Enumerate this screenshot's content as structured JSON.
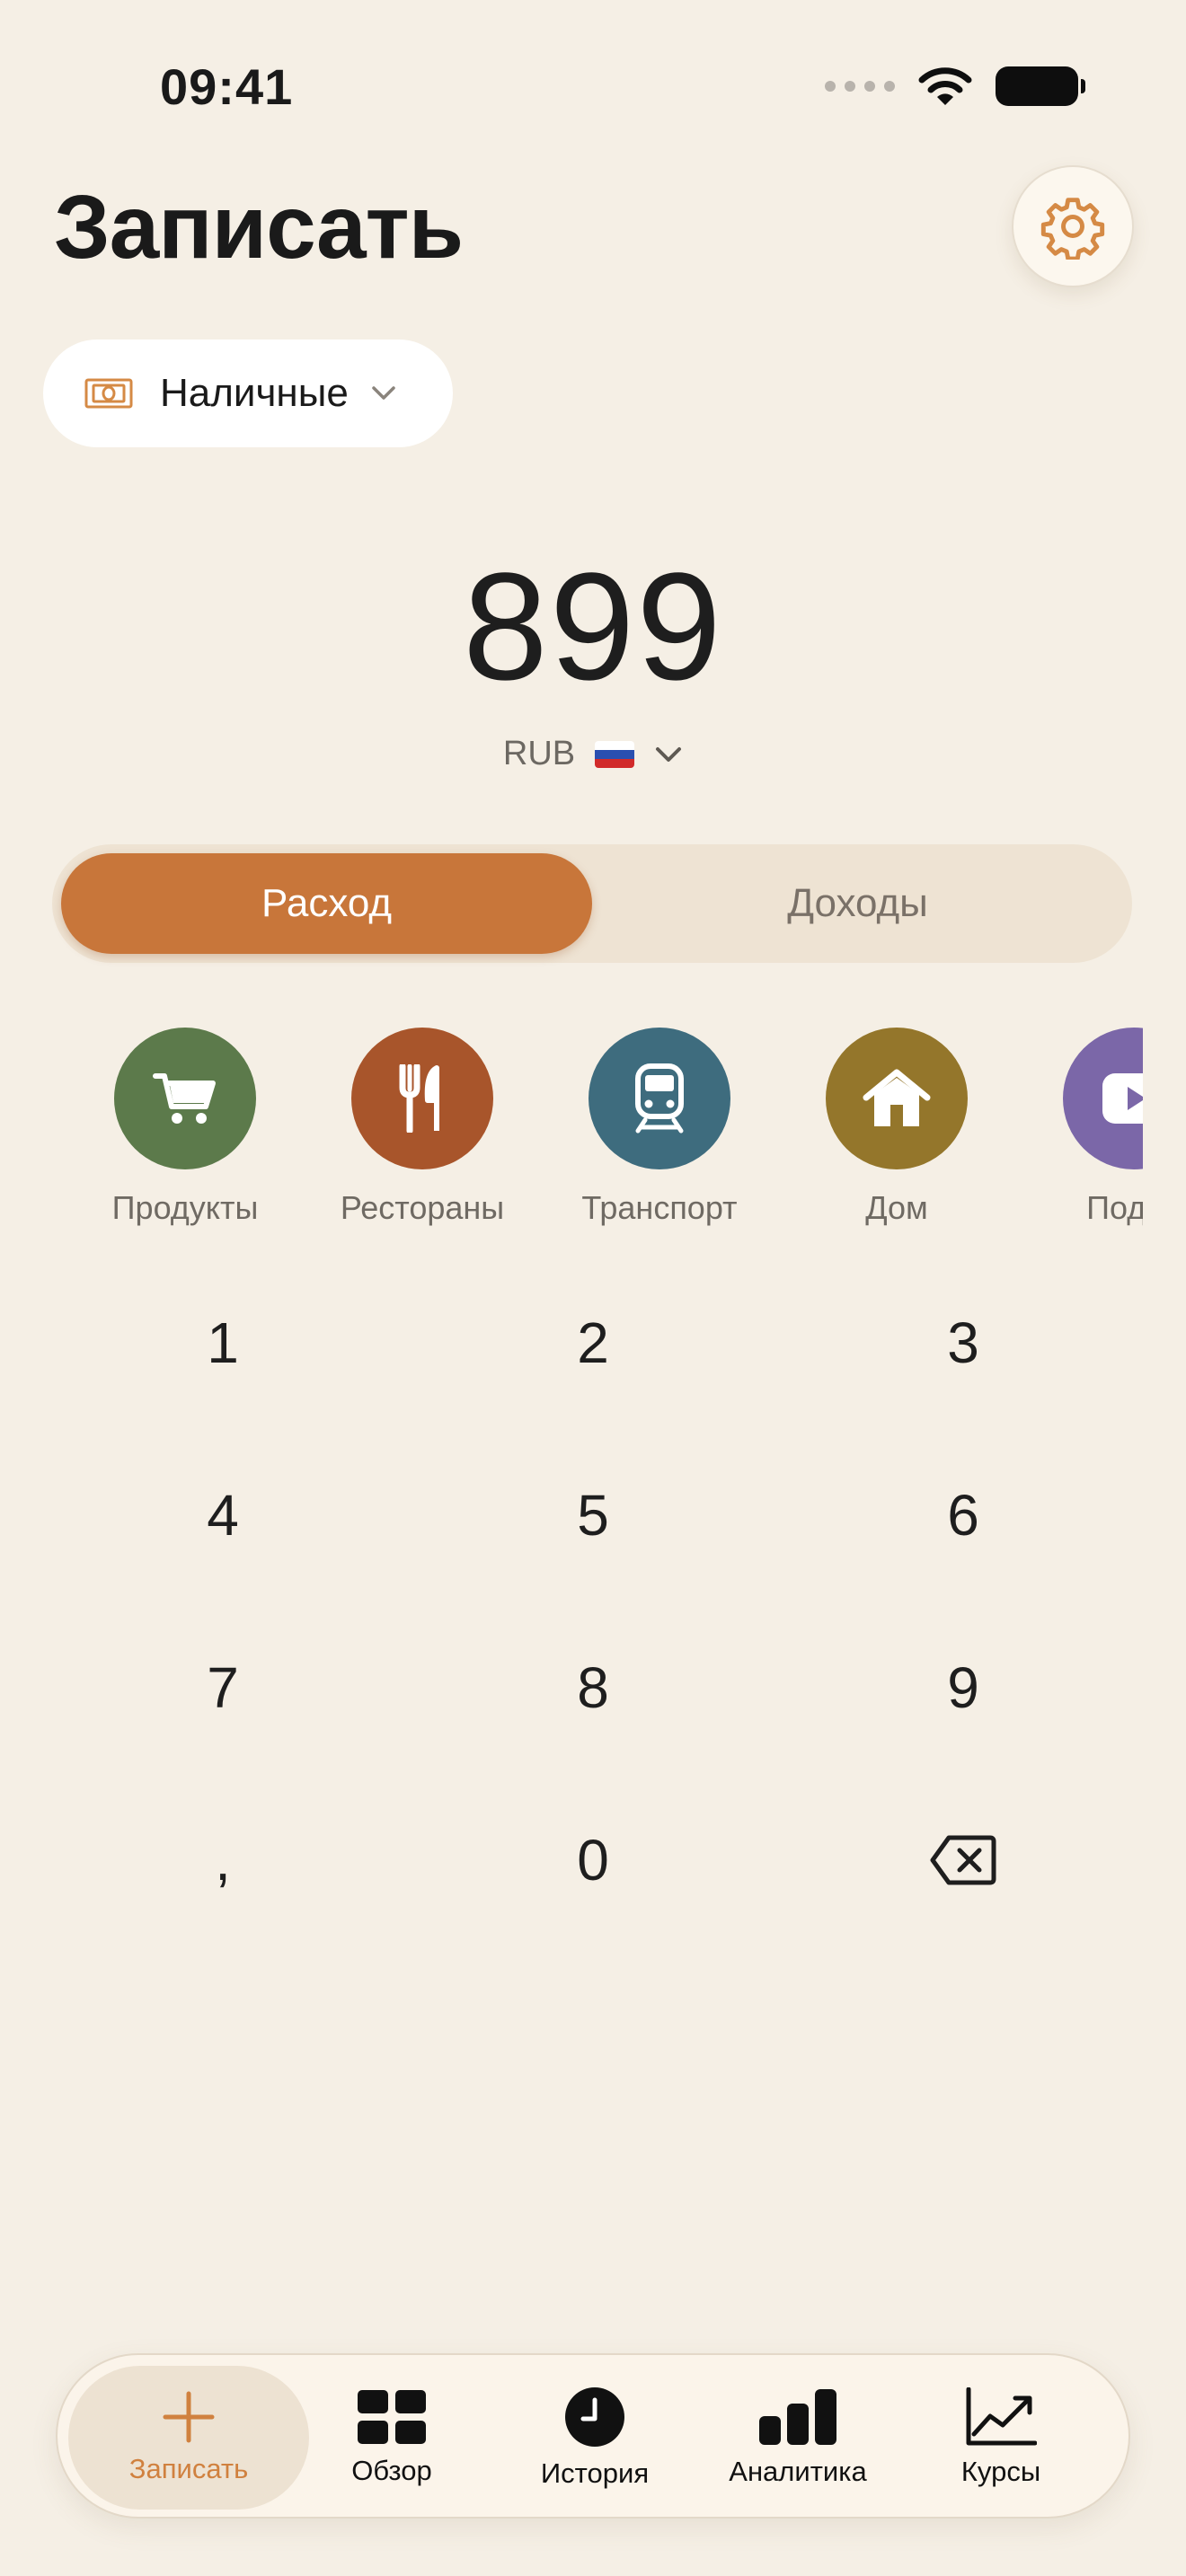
{
  "status_bar": {
    "time": "09:41"
  },
  "header": {
    "title": "Записать",
    "settings_icon": "gear-icon"
  },
  "account": {
    "label": "Наличные",
    "icon": "cash-icon"
  },
  "amount": {
    "value": "899",
    "currency": "RUB"
  },
  "type_toggle": {
    "expense": "Расход",
    "income": "Доходы",
    "selected": "expense"
  },
  "categories": [
    {
      "label": "Продукты",
      "color": "#5C7A4B",
      "icon": "cart-icon"
    },
    {
      "label": "Рестораны",
      "color": "#A8552B",
      "icon": "fork-knife-icon"
    },
    {
      "label": "Транспорт",
      "color": "#3E6C7E",
      "icon": "train-icon"
    },
    {
      "label": "Дом",
      "color": "#94762B",
      "icon": "house-icon"
    },
    {
      "label": "Подпи",
      "color": "#7B67A8",
      "icon": "play-icon"
    }
  ],
  "keypad": {
    "keys": [
      "1",
      "2",
      "3",
      "4",
      "5",
      "6",
      "7",
      "8",
      "9",
      ",",
      "0"
    ],
    "backspace_icon": "backspace-icon"
  },
  "tabs": [
    {
      "label": "Записать",
      "icon": "plus-icon",
      "active": true
    },
    {
      "label": "Обзор",
      "icon": "grid-icon"
    },
    {
      "label": "История",
      "icon": "clock-icon"
    },
    {
      "label": "Аналитика",
      "icon": "bar-chart-icon"
    },
    {
      "label": "Курсы",
      "icon": "trend-icon"
    }
  ],
  "colors": {
    "background": "#F5EFE5",
    "accent": "#C8763A",
    "segment_bg": "#EEE3D3",
    "tab_active_label": "#D0813F"
  }
}
